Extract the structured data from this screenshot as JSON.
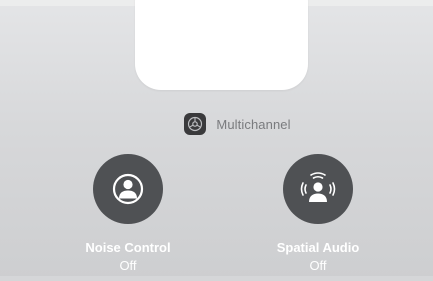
{
  "route": {
    "label": "Multichannel",
    "icon": "multichannel-icon"
  },
  "controls": [
    {
      "title": "Noise Control",
      "value": "Off",
      "icon": "noise-control-icon"
    },
    {
      "title": "Spatial Audio",
      "value": "Off",
      "icon": "spatial-audio-icon"
    }
  ],
  "colors": {
    "background": "#d9dadc",
    "slider": "#ffffff",
    "button": "#4f5154",
    "text_primary": "#ffffff",
    "text_secondary": "#7a7b7e"
  }
}
